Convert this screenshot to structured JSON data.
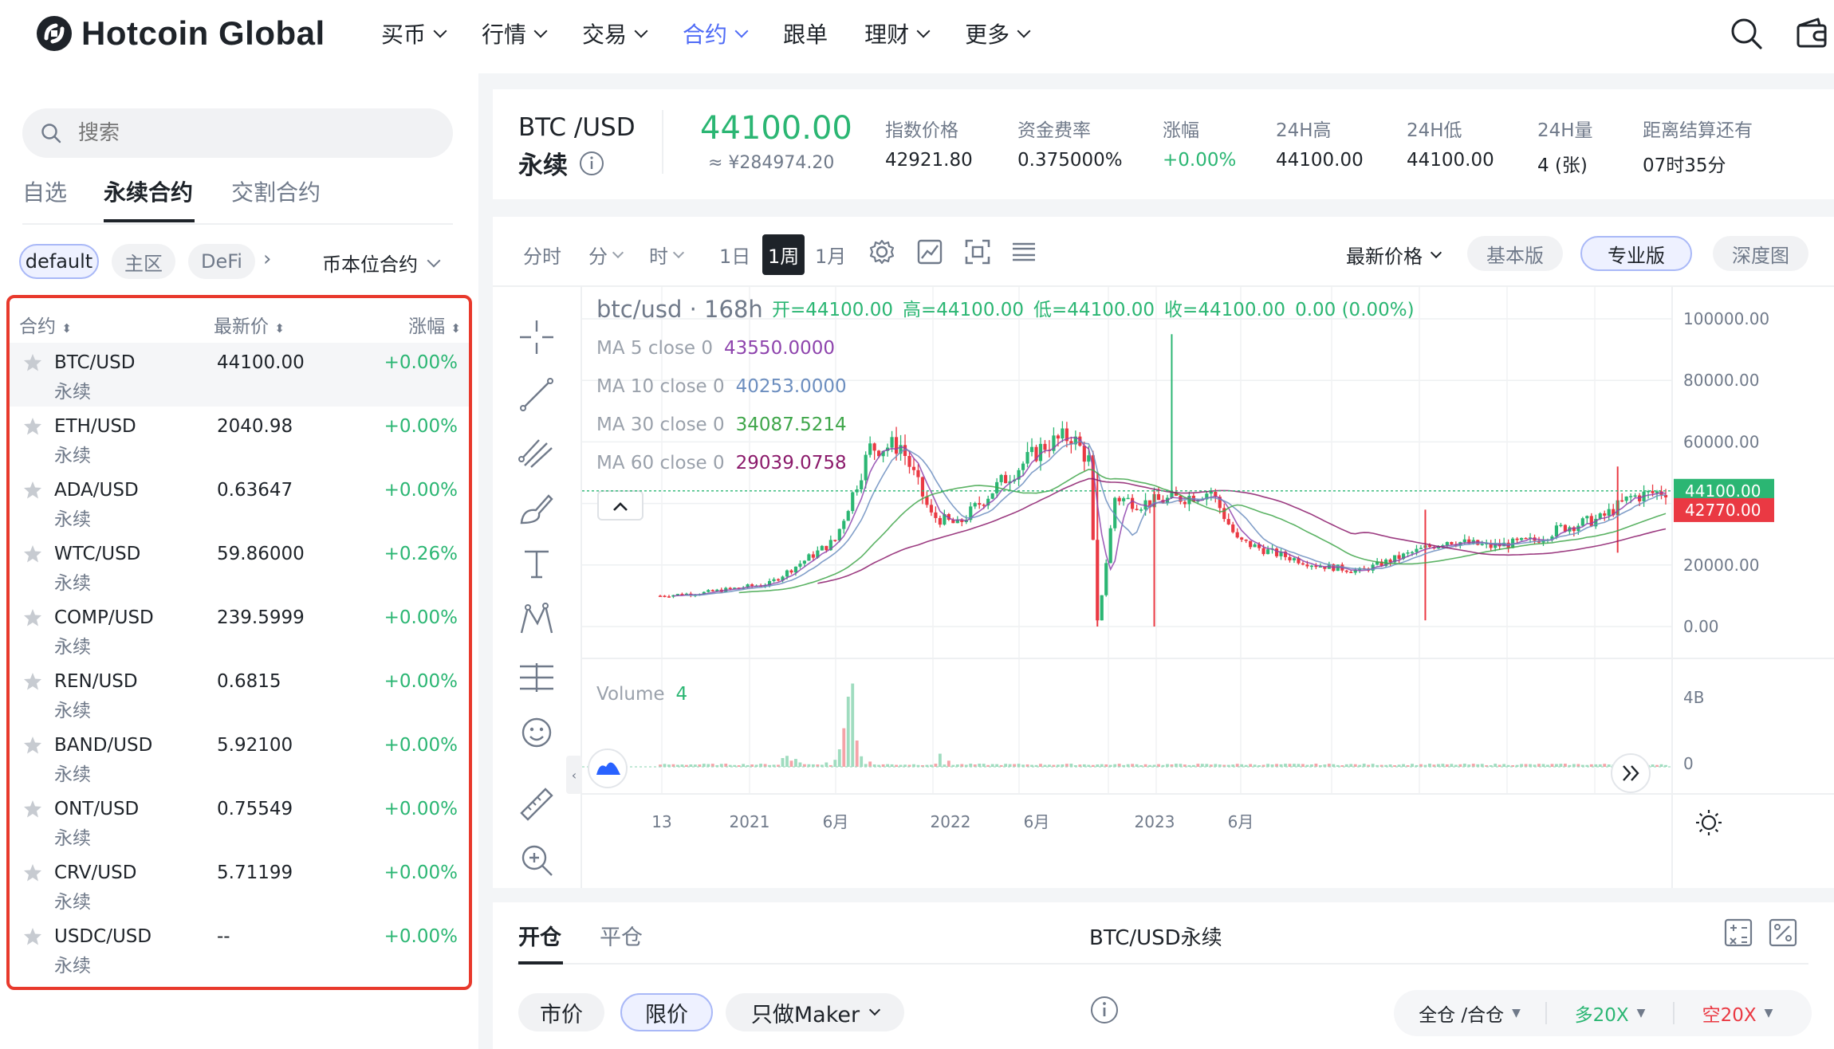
{
  "brand": "Hotcoin Global",
  "nav": [
    {
      "label": "买币",
      "dropdown": true
    },
    {
      "label": "行情",
      "dropdown": true
    },
    {
      "label": "交易",
      "dropdown": true
    },
    {
      "label": "合约",
      "dropdown": true,
      "active": true
    },
    {
      "label": "跟单",
      "dropdown": false
    },
    {
      "label": "理财",
      "dropdown": true
    },
    {
      "label": "更多",
      "dropdown": true
    }
  ],
  "sidebar": {
    "search_placeholder": "搜索",
    "tabs": [
      "自选",
      "永续合约",
      "交割合约"
    ],
    "active_tab": 1,
    "filters": [
      "default",
      "主区",
      "DeFi"
    ],
    "currency_select": "币本位合约",
    "columns": {
      "contract": "合约",
      "price": "最新价",
      "change": "涨幅"
    },
    "markets": [
      {
        "symbol": "BTC/USD",
        "type": "永续",
        "price": "44100.00",
        "change": "+0.00%"
      },
      {
        "symbol": "ETH/USD",
        "type": "永续",
        "price": "2040.98",
        "change": "+0.00%"
      },
      {
        "symbol": "ADA/USD",
        "type": "永续",
        "price": "0.63647",
        "change": "+0.00%"
      },
      {
        "symbol": "WTC/USD",
        "type": "永续",
        "price": "59.86000",
        "change": "+0.26%"
      },
      {
        "symbol": "COMP/USD",
        "type": "永续",
        "price": "239.5999",
        "change": "+0.00%"
      },
      {
        "symbol": "REN/USD",
        "type": "永续",
        "price": "0.6815",
        "change": "+0.00%"
      },
      {
        "symbol": "BAND/USD",
        "type": "永续",
        "price": "5.92100",
        "change": "+0.00%"
      },
      {
        "symbol": "ONT/USD",
        "type": "永续",
        "price": "0.75549",
        "change": "+0.00%"
      },
      {
        "symbol": "CRV/USD",
        "type": "永续",
        "price": "5.71199",
        "change": "+0.00%"
      },
      {
        "symbol": "USDC/USD",
        "type": "永续",
        "price": "--",
        "change": "+0.00%"
      }
    ]
  },
  "ticker": {
    "pair": "BTC /USD",
    "contract_type": "永续",
    "last_price": "44100.00",
    "cny_price": "≈ ¥284974.20",
    "stats": [
      {
        "label": "指数价格",
        "value": "42921.80"
      },
      {
        "label": "资金费率",
        "value": "0.375000%"
      },
      {
        "label": "涨幅",
        "value": "+0.00%"
      },
      {
        "label": "24H高",
        "value": "44100.00"
      },
      {
        "label": "24H低",
        "value": "44100.00"
      },
      {
        "label": "24H量",
        "value": "4 (张)"
      },
      {
        "label": "距离结算还有",
        "value": "07时35分"
      }
    ]
  },
  "toolbar": {
    "intervals": [
      "分时",
      "分",
      "时",
      "1日",
      "1周",
      "1月"
    ],
    "active_interval": "1周",
    "price_type": "最新价格",
    "views": [
      "基本版",
      "专业版",
      "深度图"
    ],
    "active_view": "专业版"
  },
  "chart_data": {
    "type": "candlestick",
    "symbol_label": "btc/usd",
    "timeframe_label": "168h",
    "ohlc_label": {
      "open": "开=44100.00",
      "high": "高=44100.00",
      "low": "低=44100.00",
      "close": "收=44100.00",
      "change": "0.00 (0.00%)"
    },
    "ma_legend": [
      {
        "label": "MA 5 close 0",
        "value": "43550.0000",
        "color": "#8e44ad"
      },
      {
        "label": "MA 10 close 0",
        "value": "40253.0000",
        "color": "#6c8ebf"
      },
      {
        "label": "MA 30 close 0",
        "value": "34087.5214",
        "color": "#3fa64a"
      },
      {
        "label": "MA 60 close 0",
        "value": "29039.0758",
        "color": "#8b1a6b"
      }
    ],
    "y_ticks": [
      "100000.00",
      "80000.00",
      "60000.00",
      "40000.00",
      "20000.00",
      "0.00"
    ],
    "ylim": [
      0,
      100000
    ],
    "current_price_tag": "44100.00",
    "secondary_price_tag": "42770.00",
    "volume_label": "Volume",
    "volume_value": "4",
    "volume_ticks": [
      "4B",
      "0"
    ],
    "x_ticks": [
      "13",
      "2021",
      "6月",
      "2022",
      "6月",
      "2023",
      "6月"
    ],
    "colors": {
      "up": "#2bb673",
      "down": "#ea3943"
    }
  },
  "order": {
    "tabs": [
      "开仓",
      "平仓"
    ],
    "title": "BTC/USD永续",
    "types": [
      "市价",
      "限价",
      "只做Maker"
    ],
    "active_type": "限价",
    "margin_mode": "全仓 /合仓",
    "long_leverage": "多20X",
    "short_leverage": "空20X"
  }
}
